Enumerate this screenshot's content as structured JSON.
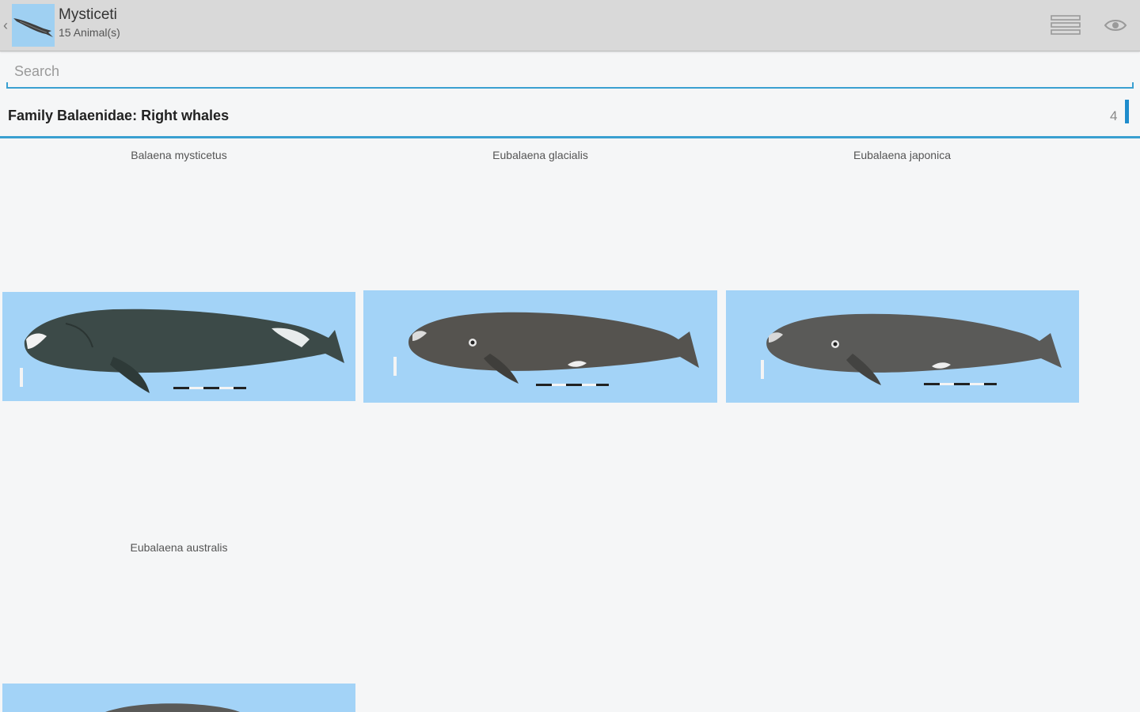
{
  "actionbar": {
    "title": "Mysticeti",
    "subtitle": "15 Animal(s)",
    "up_icon": "chevron-left-icon",
    "menu_icon": "list-icon",
    "eye_icon": "eye-icon"
  },
  "search": {
    "placeholder": "Search",
    "value": ""
  },
  "section": {
    "title": "Family Balaenidae: Right whales",
    "count": "4"
  },
  "animals": [
    {
      "name": "Balaena mysticetus",
      "whale_color": "#3c4a48"
    },
    {
      "name": "Eubalaena glacialis",
      "whale_color": "#55534f"
    },
    {
      "name": "Eubalaena japonica",
      "whale_color": "#5a5a58"
    },
    {
      "name": "Eubalaena australis",
      "whale_color": "#5a5a58"
    }
  ],
  "colors": {
    "actionbar_bg": "#d9d9d9",
    "accent": "#3aa0d1",
    "thumb_bg": "#a3d3f7"
  }
}
